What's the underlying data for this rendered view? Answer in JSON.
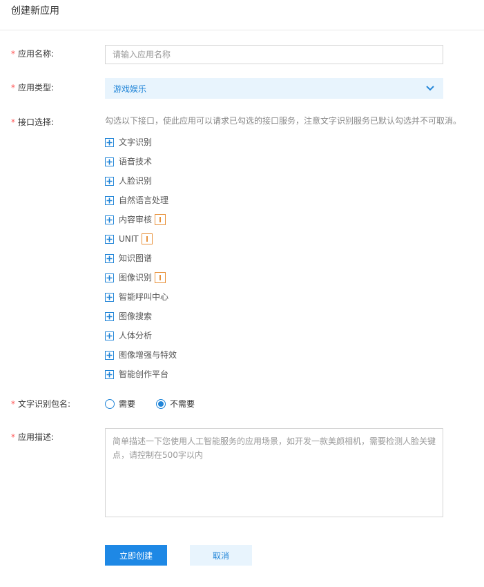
{
  "header": {
    "title": "创建新应用"
  },
  "form": {
    "required_mark": "*",
    "app_name": {
      "label": "应用名称:",
      "value": "",
      "placeholder": "请输入应用名称"
    },
    "app_type": {
      "label": "应用类型:",
      "selected": "游戏娱乐",
      "icon": "chevron-down-icon"
    },
    "api_select": {
      "label": "接口选择:",
      "note": "勾选以下接口，使此应用可以请求已勾选的接口服务，注意文字识别服务已默认勾选并不可取消。",
      "items": [
        {
          "label": "文字识别",
          "warn": false
        },
        {
          "label": "语音技术",
          "warn": false
        },
        {
          "label": "人脸识别",
          "warn": false
        },
        {
          "label": "自然语言处理",
          "warn": false
        },
        {
          "label": "内容审核",
          "warn": true
        },
        {
          "label": "UNIT",
          "warn": true
        },
        {
          "label": "知识图谱",
          "warn": false
        },
        {
          "label": "图像识别",
          "warn": true
        },
        {
          "label": "智能呼叫中心",
          "warn": false
        },
        {
          "label": "图像搜索",
          "warn": false
        },
        {
          "label": "人体分析",
          "warn": false
        },
        {
          "label": "图像增强与特效",
          "warn": false
        },
        {
          "label": "智能创作平台",
          "warn": false
        }
      ]
    },
    "ocr_package": {
      "label": "文字识别包名:",
      "options": [
        {
          "label": "需要",
          "checked": false
        },
        {
          "label": "不需要",
          "checked": true
        }
      ]
    },
    "description": {
      "label": "应用描述:",
      "value": "",
      "placeholder": "简单描述一下您使用人工智能服务的应用场景，如开发一款美颜相机，需要检测人脸关键点，请控制在500字以内"
    }
  },
  "actions": {
    "create_label": "立即创建",
    "cancel_label": "取消"
  },
  "colors": {
    "accent": "#1e88e5",
    "required": "#ff5555",
    "warning": "#e8913a",
    "select_bg": "#e8f4fd"
  }
}
